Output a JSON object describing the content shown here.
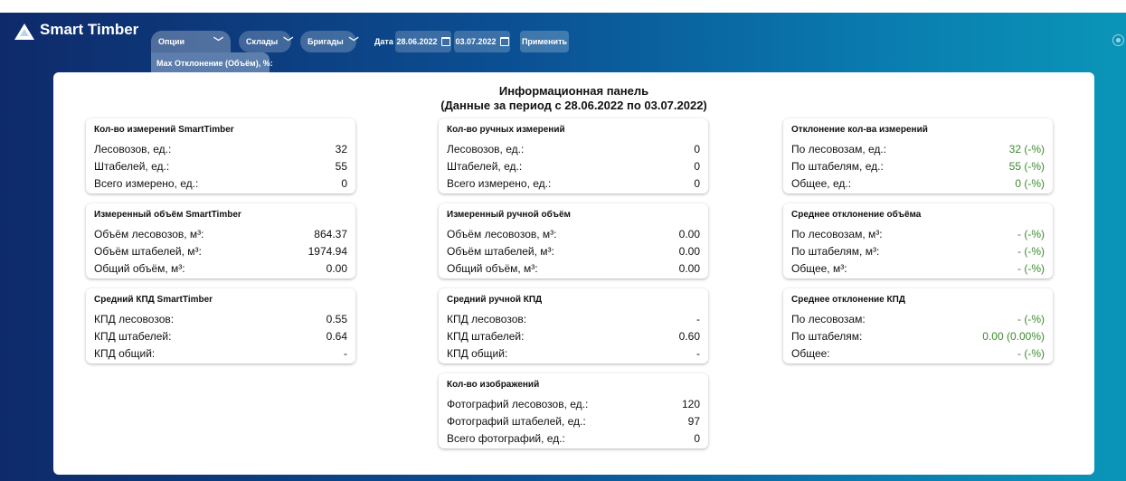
{
  "header": {
    "brand": "Smart Timber",
    "options_label": "Опции",
    "options_panel_label": "Max Отклонение (Объём), %:",
    "options_panel_value": "",
    "warehouses_label": "Склады",
    "teams_label": "Бригады",
    "date_label": "Дата",
    "date_from": "28.06.2022",
    "date_to": "03.07.2022",
    "apply_label": "Применить"
  },
  "panel": {
    "title": "Информационная панель",
    "subtitle": "(Данные за период с 28.06.2022 по 03.07.2022)"
  },
  "columns": [
    {
      "cards": [
        {
          "title": "Кол-во измерений SmartTimber",
          "rows": [
            {
              "label": "Лесовозов, ед.:",
              "value": "32"
            },
            {
              "label": "Штабелей, ед.:",
              "value": "55"
            },
            {
              "label": "Всего измерено, ед.:",
              "value": "0"
            }
          ]
        },
        {
          "title": "Измеренный объём SmartTimber",
          "rows": [
            {
              "label": "Объём лесовозов, м³:",
              "value": "864.37"
            },
            {
              "label": "Объём штабелей, м³:",
              "value": "1974.94"
            },
            {
              "label": "Общий объём, м³:",
              "value": "0.00"
            }
          ]
        },
        {
          "title": "Средний КПД SmartTimber",
          "rows": [
            {
              "label": "КПД лесовозов:",
              "value": "0.55"
            },
            {
              "label": "КПД штабелей:",
              "value": "0.64"
            },
            {
              "label": "КПД общий:",
              "value": "-"
            }
          ]
        }
      ]
    },
    {
      "cards": [
        {
          "title": "Кол-во ручных измерений",
          "rows": [
            {
              "label": "Лесовозов, ед.:",
              "value": "0"
            },
            {
              "label": "Штабелей, ед.:",
              "value": "0"
            },
            {
              "label": "Всего измерено, ед.:",
              "value": "0"
            }
          ]
        },
        {
          "title": "Измеренный ручной объём",
          "rows": [
            {
              "label": "Объём лесовозов, м³:",
              "value": "0.00"
            },
            {
              "label": "Объём штабелей, м³:",
              "value": "0.00"
            },
            {
              "label": "Общий объём, м³:",
              "value": "0.00"
            }
          ]
        },
        {
          "title": "Средний ручной КПД",
          "rows": [
            {
              "label": "КПД лесовозов:",
              "value": "-"
            },
            {
              "label": "КПД штабелей:",
              "value": "0.60"
            },
            {
              "label": "КПД общий:",
              "value": "-"
            }
          ]
        },
        {
          "title": "Кол-во изображений",
          "rows": [
            {
              "label": "Фотографий лесовозов, ед.:",
              "value": "120"
            },
            {
              "label": "Фотографий штабелей, ед.:",
              "value": "97"
            },
            {
              "label": "Всего фотографий, ед.:",
              "value": "0"
            }
          ]
        }
      ]
    },
    {
      "cards": [
        {
          "title": "Отклонение кол-ва измерений",
          "rows": [
            {
              "label": "По лесовозам, ед.:",
              "value": "32 (-%)"
            },
            {
              "label": "По штабелям, ед.:",
              "value": "55 (-%)"
            },
            {
              "label": "Общее, ед.:",
              "value": "0 (-%)"
            }
          ]
        },
        {
          "title": "Среднее отклонение объёма",
          "rows": [
            {
              "label": "По лесовозам, м³:",
              "value": "- (-%)"
            },
            {
              "label": "По штабелям, м³:",
              "value": "- (-%)"
            },
            {
              "label": "Общее, м³:",
              "value": "- (-%)"
            }
          ]
        },
        {
          "title": "Среднее отклонение КПД",
          "rows": [
            {
              "label": "По лесовозам:",
              "value": "- (-%)"
            },
            {
              "label": "По штабелям:",
              "value": "0.00 (0.00%)"
            },
            {
              "label": "Общее:",
              "value": "- (-%)"
            }
          ]
        }
      ]
    }
  ],
  "colors": {
    "deviation_value": "#3c8a2e",
    "header_start": "#0e2a6a",
    "header_end": "#0a95b8"
  }
}
